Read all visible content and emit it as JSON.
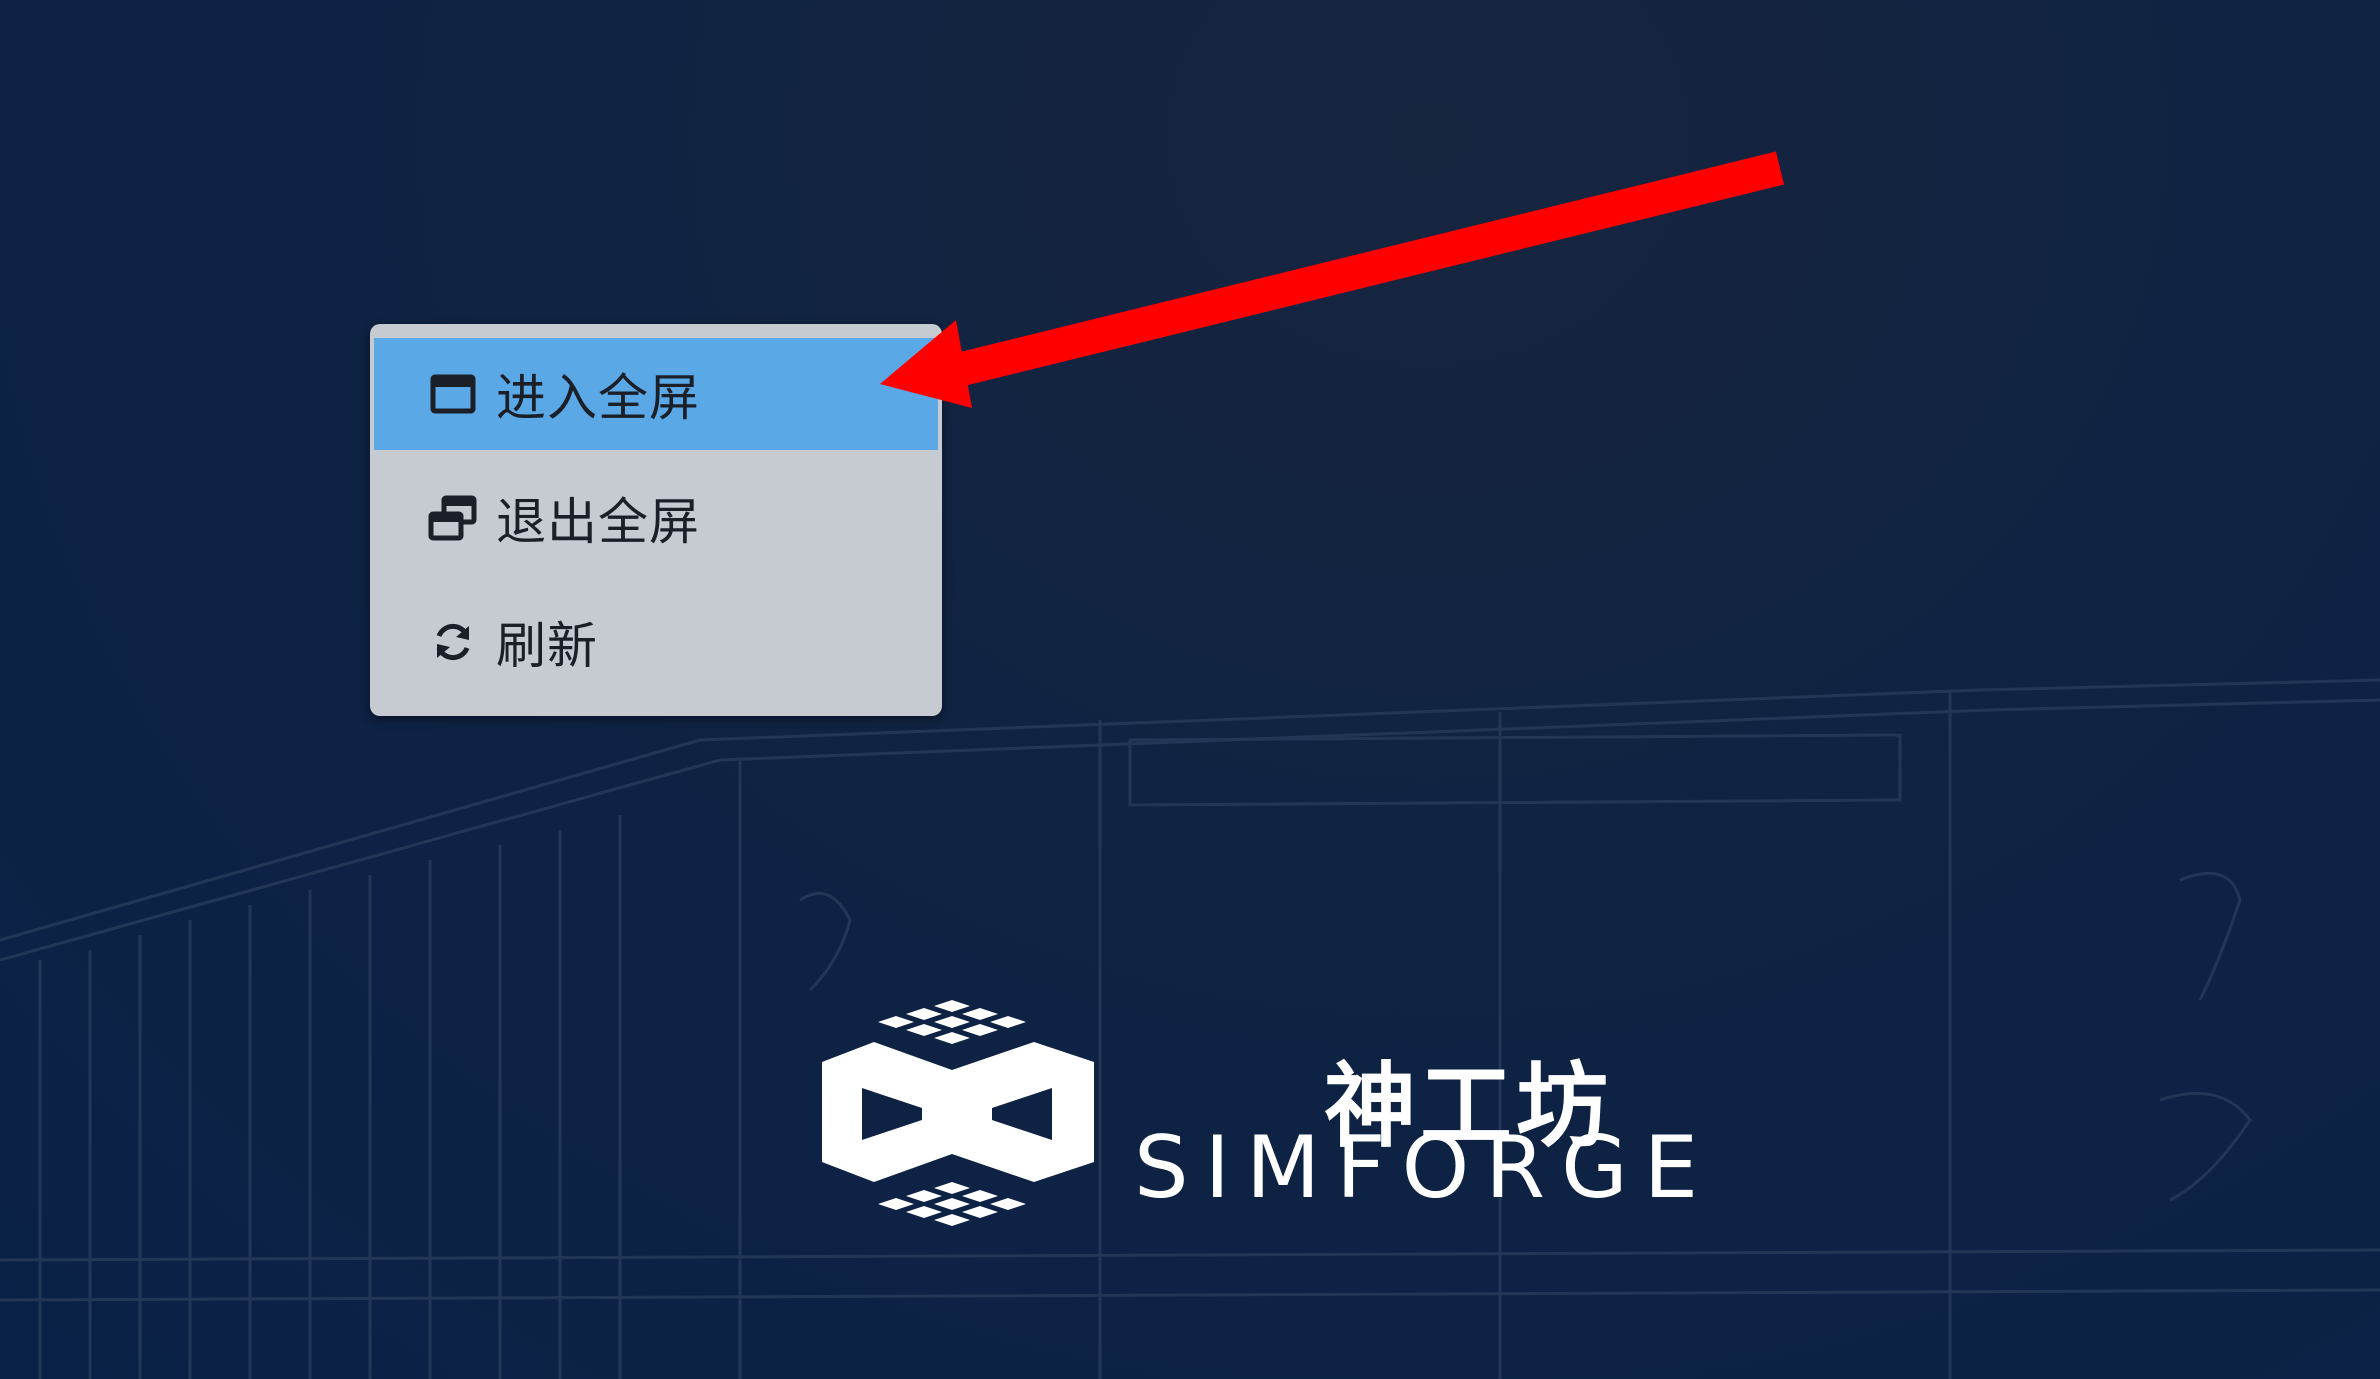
{
  "context_menu": {
    "items": [
      {
        "label": "进入全屏",
        "icon": "maximize-window-icon",
        "active": true
      },
      {
        "label": "退出全屏",
        "icon": "restore-window-icon",
        "active": false
      },
      {
        "label": "刷新",
        "icon": "refresh-icon",
        "active": false
      }
    ],
    "highlight_color": "#5aa8e6",
    "background_color": "#c6cad1"
  },
  "annotation": {
    "arrow_color": "#ff0000"
  },
  "logo": {
    "chinese_name": "神工坊",
    "english_name": "SIMFORGE"
  },
  "colors": {
    "background": "#0f2342"
  }
}
